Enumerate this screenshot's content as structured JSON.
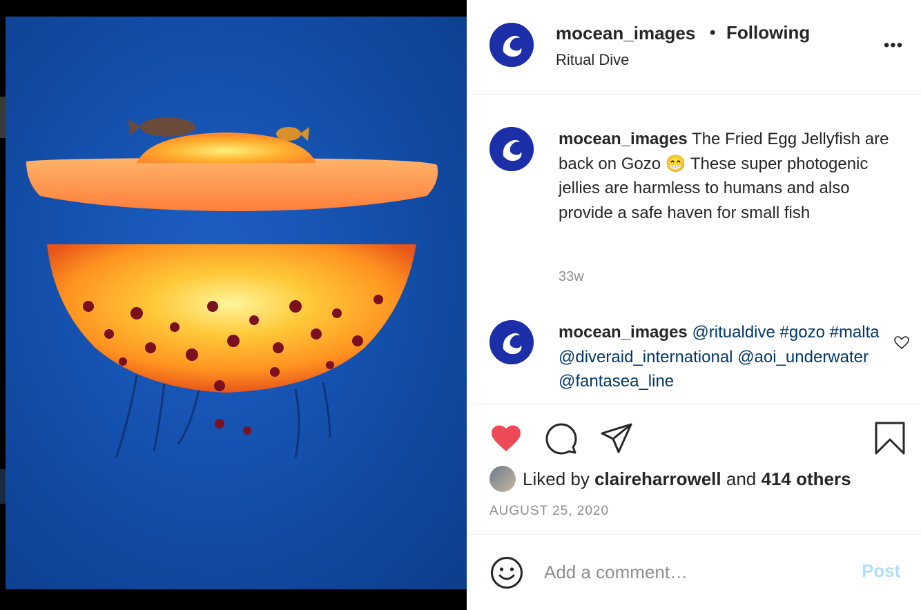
{
  "post": {
    "username": "mocean_images",
    "separator": "•",
    "follow_state": "Following",
    "location": "Ritual Dive",
    "more_label": "•••"
  },
  "caption": {
    "author": "mocean_images",
    "text": "The Fried Egg Jellyfish are back on Gozo 😁 These super photogenic jellies are harmless to humans and also provide a safe haven for small fish",
    "age": "33w"
  },
  "comment": {
    "author": "mocean_images",
    "tags": [
      "@ritualdive",
      "#gozo",
      "#malta",
      "@diveraid_international",
      "@aoi_underwater",
      "@fantasea_line"
    ]
  },
  "likes": {
    "prefix": "Liked by",
    "user": "claireharrowell",
    "joiner": "and",
    "others": "414 others"
  },
  "date": "AUGUST 25, 2020",
  "comment_box": {
    "placeholder": "Add a comment…",
    "post_label": "Post"
  },
  "colors": {
    "like_active": "#ed4956",
    "tag_link": "#00376b",
    "post_disabled": "#b2dffc",
    "avatar_bg": "#1c2fa8"
  }
}
